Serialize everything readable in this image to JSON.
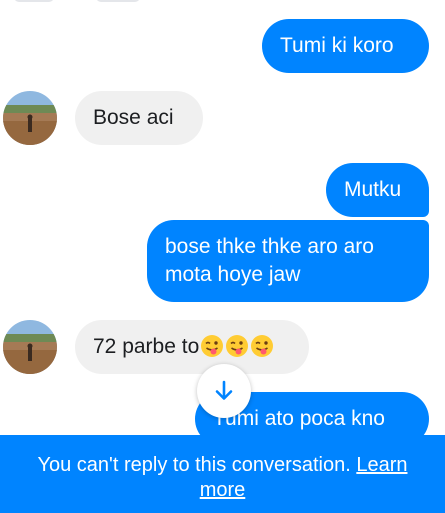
{
  "messages": [
    {
      "id": "m1",
      "direction": "outgoing",
      "text": "Tumi ki koro"
    },
    {
      "id": "m2",
      "direction": "incoming",
      "text": "Bose aci"
    },
    {
      "id": "m3",
      "direction": "outgoing",
      "text": "Mutku"
    },
    {
      "id": "m4",
      "direction": "outgoing",
      "lines": [
        "bose thke thke aro aro",
        "mota hoye jaw"
      ]
    },
    {
      "id": "m5",
      "direction": "incoming",
      "text": "72 parbe to",
      "emoji": [
        "winking-tongue-emoji",
        "winking-tongue-emoji",
        "winking-tongue-emoji"
      ]
    },
    {
      "id": "m6",
      "direction": "outgoing",
      "text": "Tumi ato poca kno"
    }
  ],
  "jump_button": {
    "icon": "arrow-down-icon"
  },
  "footer": {
    "notice": "You can't reply to this conversation.",
    "link": "Learn more"
  },
  "colors": {
    "outgoing_bubble": "#0084ff",
    "incoming_bubble": "#f0f0f0",
    "footer_bg": "#0084ff",
    "text_dark": "#1c1e21"
  }
}
